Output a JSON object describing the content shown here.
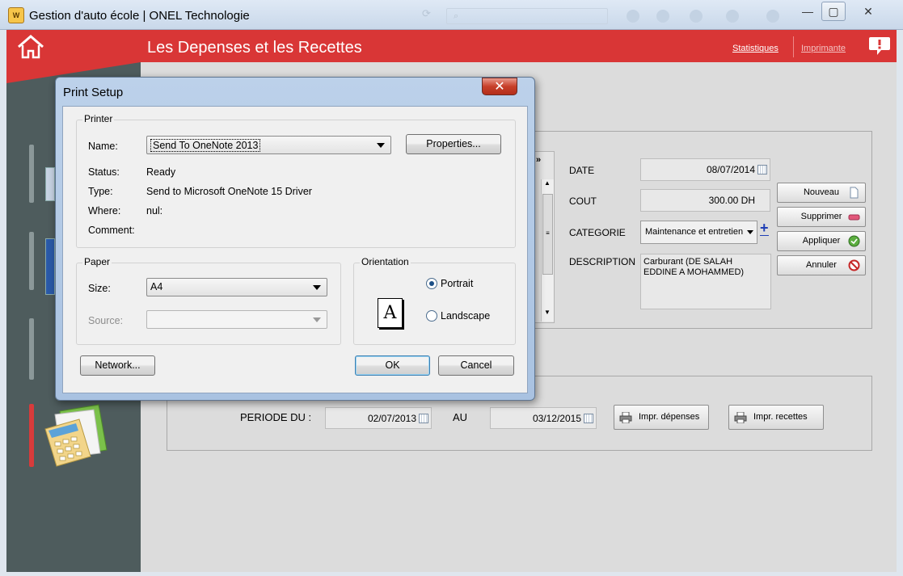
{
  "window": {
    "title": "Gestion d'auto école | ONEL Technologie",
    "app_icon": "wd-app-icon",
    "buttons": {
      "minimize": "minimize-icon",
      "maximize": "maximize-icon",
      "close": "close-icon"
    }
  },
  "header": {
    "title": "Les Depenses et les Recettes",
    "links": {
      "statistics": "Statistiques",
      "print": "Imprimante"
    },
    "accent_color": "#d93636"
  },
  "form": {
    "date_label": "DATE",
    "date_value": "08/07/2014",
    "cout_label": "COUT",
    "cout_value": "300.00 DH",
    "categorie_label": "CATEGORIE",
    "categorie_value": "Maintenance et entretien",
    "description_label": "DESCRIPTION",
    "description_value": "Carburant (DE SALAH EDDINE A MOHAMMED)",
    "buttons": {
      "nouveau": "Nouveau",
      "supprimer": "Supprimer",
      "appliquer": "Appliquer",
      "annuler": "Annuler"
    }
  },
  "periode": {
    "du_label": "PERIODE DU :",
    "du_value": "02/07/2013",
    "au_label": "AU",
    "au_value": "03/12/2015",
    "print_expenses": "Impr. dépenses",
    "print_receipts": "Impr. recettes"
  },
  "dialog": {
    "title": "Print Setup",
    "printer_group": "Printer",
    "name_label": "Name:",
    "name_value": "Send To OneNote 2013",
    "properties_button": "Properties...",
    "status_label": "Status:",
    "status_value": "Ready",
    "type_label": "Type:",
    "type_value": "Send to Microsoft OneNote 15 Driver",
    "where_label": "Where:",
    "where_value": "nul:",
    "comment_label": "Comment:",
    "comment_value": "",
    "paper_group": "Paper",
    "size_label": "Size:",
    "size_value": "A4",
    "source_label": "Source:",
    "source_value": "",
    "orientation_group": "Orientation",
    "orientation_preview": "A",
    "portrait_label": "Portrait",
    "landscape_label": "Landscape",
    "orientation_selected": "Portrait",
    "network_button": "Network...",
    "ok_button": "OK",
    "cancel_button": "Cancel"
  }
}
